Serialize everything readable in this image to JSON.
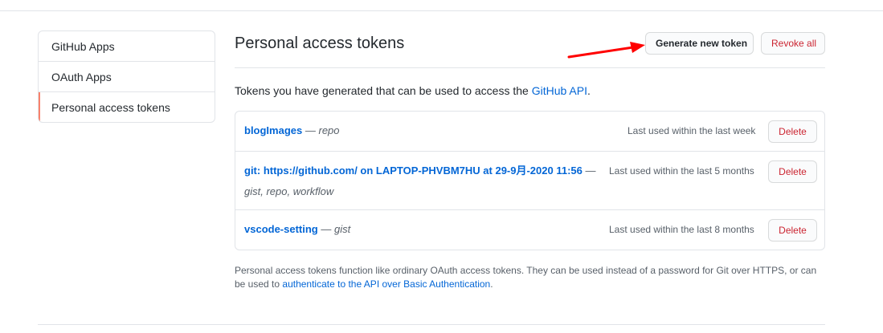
{
  "sidebar": {
    "items": [
      {
        "label": "GitHub Apps"
      },
      {
        "label": "OAuth Apps"
      },
      {
        "label": "Personal access tokens"
      }
    ]
  },
  "header": {
    "title": "Personal access tokens",
    "generate_label": "Generate new token",
    "revoke_label": "Revoke all"
  },
  "intro": {
    "text_before": "Tokens you have generated that can be used to access the ",
    "link": "GitHub API",
    "text_after": "."
  },
  "tokens": [
    {
      "name": "blogImages",
      "separator": " — ",
      "scopes": "repo",
      "last_used": "Last used within the last week",
      "delete_label": "Delete"
    },
    {
      "name": "git: https://github.com/ on LAPTOP-PHVBM7HU at 29-9月-2020 11:56",
      "separator": " — ",
      "scopes": "gist, repo, workflow",
      "last_used": "Last used within the last 5 months",
      "delete_label": "Delete"
    },
    {
      "name": "vscode-setting",
      "separator": " — ",
      "scopes": "gist",
      "last_used": "Last used within the last 8 months",
      "delete_label": "Delete"
    }
  ],
  "footnote": {
    "text_before": "Personal access tokens function like ordinary OAuth access tokens. They can be used instead of a password for Git over HTTPS, or can be used to ",
    "link": "authenticate to the API over Basic Authentication",
    "text_after": "."
  },
  "colors": {
    "link": "#0366d6",
    "danger": "#cb2431",
    "selected_marker": "#f9826c",
    "annotation_arrow": "#ff0000"
  },
  "icons": {
    "annotation": "red-arrow"
  }
}
